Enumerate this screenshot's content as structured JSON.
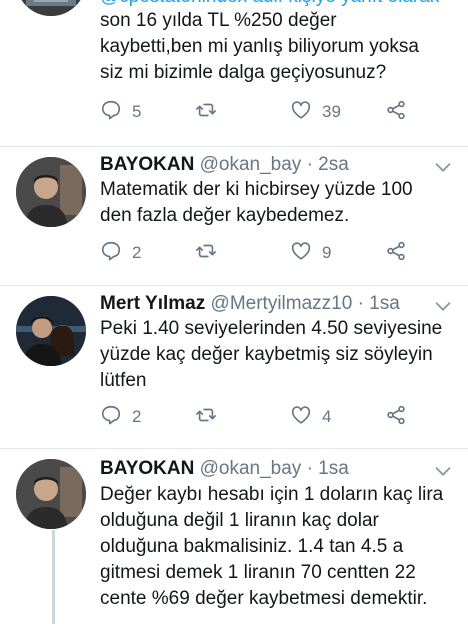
{
  "top_tweet": {
    "header_partial": "@cpostatonindex adlı kişiye yanıt olarak",
    "text": "son 16 yılda  TL  %250 değer\nkaybetti,ben mi yanlış biliyorum yoksa\nsiz mi bizimle dalga geçiyosunuz?",
    "reply_count": "5",
    "retweet_count": "",
    "like_count": "39"
  },
  "tweets": [
    {
      "name": "BAYOKAN",
      "handle": "@okan_bay · 2sa",
      "text": "Matematik der ki hicbirsey yüzde 100\nden fazla değer kaybedemez.",
      "reply_count": "2",
      "retweet_count": "",
      "like_count": "9"
    },
    {
      "name": "Mert Yılmaz",
      "handle": "@Mertyilmazz10 · 1sa",
      "text": "Peki 1.40 seviyelerinden 4.50 seviyesine\nyüzde kaç değer kaybetmiş siz söyleyin\nlütfen",
      "reply_count": "2",
      "retweet_count": "",
      "like_count": "4"
    },
    {
      "name": "BAYOKAN",
      "handle": "@okan_bay · 1sa",
      "text": "Değer kaybı hesabı için 1 doların kaç lira\nolduğuna değil 1 liranın kaç dolar\nolduğuna bakmalisiniz. 1.4 tan 4.5 a\ngitmesi demek 1 liranın 70 centten 22\ncente %69 değer kaybetmesi demektir."
    }
  ],
  "colors": {
    "text": "#14171a",
    "muted": "#657786",
    "divider": "#e1e8ed",
    "thread": "#ccd6dd"
  },
  "icons": [
    "reply-icon",
    "retweet-icon",
    "like-icon",
    "share-icon",
    "caret-down-icon"
  ]
}
